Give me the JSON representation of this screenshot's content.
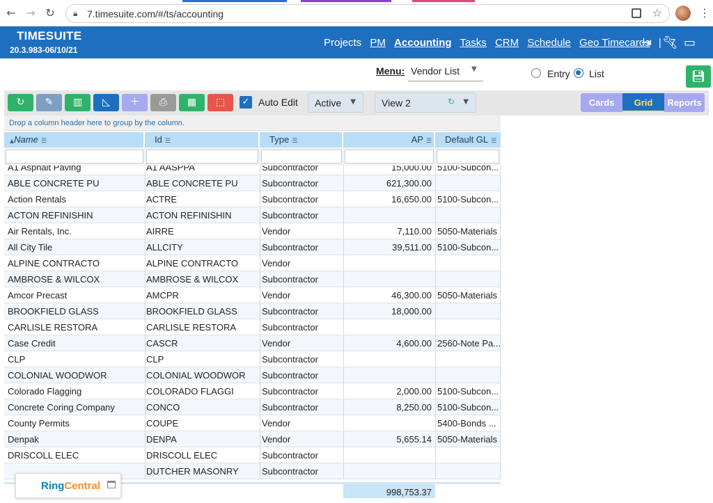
{
  "browser": {
    "url": "7.timesuite.com/#/ts/accounting"
  },
  "app": {
    "brand": "TIMESUITE",
    "version": "20.3.983-06/10/21",
    "nav": [
      "Projects",
      "PM",
      "Accounting",
      "Tasks",
      "CRM",
      "Schedule",
      "Geo Timecards"
    ],
    "active_nav": "Accounting",
    "nav_separator": "|",
    "badge_count": "7"
  },
  "menu": {
    "label": "Menu:",
    "selected": "Vendor List",
    "radio_entry": "Entry",
    "radio_list": "List",
    "radio_selected": "List"
  },
  "toolbar": {
    "auto_edit_label": "Auto Edit",
    "auto_edit_checked": true,
    "status_value": "Active",
    "view_value": "View 2",
    "buttons": [
      {
        "icon": "refresh-icon",
        "color": "#2fb36a"
      },
      {
        "icon": "pencil-icon",
        "color": "#7f9fc2"
      },
      {
        "icon": "columns-icon",
        "color": "#2fb36a"
      },
      {
        "icon": "ruler-icon",
        "color": "#1e6fc0"
      },
      {
        "icon": "plus-icon",
        "color": "#a6a8f2"
      },
      {
        "icon": "printer-icon",
        "color": "#9a9a9a"
      },
      {
        "icon": "grid-icon",
        "color": "#2fb36a"
      },
      {
        "icon": "image-export-icon",
        "color": "#e4574a"
      }
    ],
    "segments": [
      "Cards",
      "Grid",
      "Reports"
    ],
    "active_segment": "Grid"
  },
  "grid": {
    "group_hint": "Drop a column header here to group by the column.",
    "columns": [
      "Name",
      "Id",
      "Type",
      "AP",
      "Default GL"
    ],
    "sort_indicator": "▲",
    "rows": [
      [
        "A1 Asphalt Paving",
        "A1 AASPPA",
        "Subcontractor",
        "15,000.00",
        "5100-Subcon..."
      ],
      [
        "ABLE CONCRETE PU",
        "ABLE CONCRETE PU",
        "Subcontractor",
        "621,300.00",
        ""
      ],
      [
        "Action Rentals",
        "ACTRE",
        "Subcontractor",
        "16,650.00",
        "5100-Subcon..."
      ],
      [
        "ACTON REFINISHIN",
        "ACTON REFINISHIN",
        "Subcontractor",
        "",
        ""
      ],
      [
        "Air Rentals, Inc.",
        "AIRRE",
        "Vendor",
        "7,110.00",
        "5050-Materials"
      ],
      [
        "All City Tile",
        "ALLCITY",
        "Subcontractor",
        "39,511.00",
        "5100-Subcon..."
      ],
      [
        "ALPINE CONTRACTO",
        "ALPINE CONTRACTO",
        "Vendor",
        "",
        ""
      ],
      [
        "AMBROSE & WILCOX",
        "AMBROSE & WILCOX",
        "Subcontractor",
        "",
        ""
      ],
      [
        "Amcor Precast",
        "AMCPR",
        "Vendor",
        "46,300.00",
        "5050-Materials"
      ],
      [
        "BROOKFIELD GLASS",
        "BROOKFIELD GLASS",
        "Subcontractor",
        "18,000.00",
        ""
      ],
      [
        "CARLISLE RESTORA",
        "CARLISLE RESTORA",
        "Subcontractor",
        "",
        ""
      ],
      [
        "Case Credit",
        "CASCR",
        "Vendor",
        "4,600.00",
        "2560-Note Pa..."
      ],
      [
        "CLP",
        "CLP",
        "Subcontractor",
        "",
        ""
      ],
      [
        "COLONIAL WOODWOR",
        "COLONIAL WOODWOR",
        "Subcontractor",
        "",
        ""
      ],
      [
        "Colorado Flagging",
        "COLORADO FLAGGI",
        "Subcontractor",
        "2,000.00",
        "5100-Subcon..."
      ],
      [
        "Concrete Coring Company",
        "CONCO",
        "Subcontractor",
        "8,250.00",
        "5100-Subcon..."
      ],
      [
        "County Permits",
        "COUPE",
        "Vendor",
        "",
        "5400-Bonds ..."
      ],
      [
        "Denpak",
        "DENPA",
        "Vendor",
        "5,655.14",
        "5050-Materials"
      ],
      [
        "DRISCOLL ELEC",
        "DRISCOLL ELEC",
        "Subcontractor",
        "",
        ""
      ],
      [
        "",
        "DUTCHER MASONRY",
        "Subcontractor",
        "",
        ""
      ]
    ],
    "total_ap": "998,753.37"
  },
  "widget": {
    "ring": "Ring",
    "central": "Central"
  }
}
